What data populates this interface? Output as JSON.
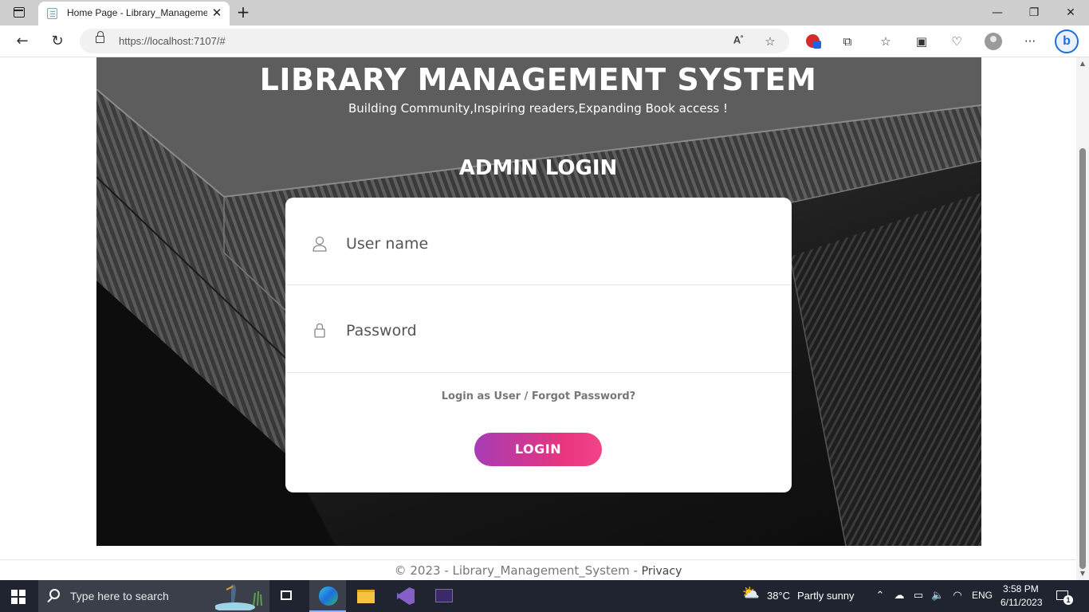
{
  "browser": {
    "tab_title": "Home Page - Library_Management_System",
    "url": "https://localhost:7107/#"
  },
  "page": {
    "site_title": "LIBRARY MANAGEMENT SYSTEM",
    "tagline": "Building Community,Inspiring readers,Expanding Book access !",
    "login_heading": "ADMIN LOGIN",
    "username_placeholder": "User name",
    "password_placeholder": "Password",
    "login_as_user": "Login as User",
    "separator": "/",
    "forgot_password": "Forgot Password?",
    "login_button": "LOGIN",
    "footer_text": "© 2023 - Library_Management_System - ",
    "footer_privacy": "Privacy"
  },
  "taskbar": {
    "search_placeholder": "Type here to search",
    "temperature": "38°C",
    "weather": "Partly sunny",
    "language": "ENG",
    "time": "3:58 PM",
    "date": "6/11/2023",
    "notifications": "1"
  },
  "colors": {
    "login_gradient_start": "#a73cb5",
    "login_gradient_end": "#f2448a",
    "edge_accent": "#1e6fd9"
  }
}
